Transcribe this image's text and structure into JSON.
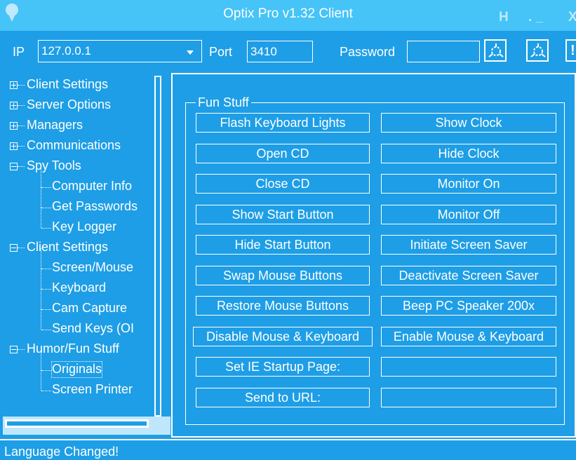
{
  "window": {
    "title": "Optix Pro v1.32 Client",
    "buttons": [
      "H",
      ". _",
      "X"
    ]
  },
  "connection": {
    "ip_label": "IP",
    "ip_value": "127.0.0.1",
    "port_label": "Port",
    "port_value": "3410",
    "password_label": "Password",
    "password_value": "",
    "action_buttons": [
      "connect-icon",
      "disconnect-icon",
      "!"
    ]
  },
  "sidebar": {
    "items": [
      {
        "label": "Client Settings",
        "level": 0,
        "expander": "plus"
      },
      {
        "label": "Server Options",
        "level": 0,
        "expander": "plus"
      },
      {
        "label": "Managers",
        "level": 0,
        "expander": "plus"
      },
      {
        "label": "Communications",
        "level": 0,
        "expander": "plus"
      },
      {
        "label": "Spy Tools",
        "level": 0,
        "expander": "minus"
      },
      {
        "label": "Computer Info",
        "level": 1
      },
      {
        "label": "Get Passwords",
        "level": 1
      },
      {
        "label": "Key Logger",
        "level": 1
      },
      {
        "label": "Client Settings",
        "level": 0,
        "expander": "minus"
      },
      {
        "label": "Screen/Mouse",
        "level": 1
      },
      {
        "label": "Keyboard",
        "level": 1
      },
      {
        "label": "Cam Capture",
        "level": 1
      },
      {
        "label": "Send Keys (OI",
        "level": 1
      },
      {
        "label": "Humor/Fun Stuff",
        "level": 0,
        "expander": "minus"
      },
      {
        "label": "Originals",
        "level": 1,
        "selected": true
      },
      {
        "label": "Screen Printer",
        "level": 1
      }
    ]
  },
  "fun_stuff": {
    "title": "Fun Stuff",
    "left_buttons": [
      "Flash Keyboard Lights",
      "Open CD",
      "Close CD",
      "Show Start Button",
      "Hide Start Button",
      "Swap Mouse Buttons",
      "Restore Mouse Buttons",
      "Disable Mouse & Keyboard",
      "Set IE Startup Page:",
      "Send to URL:"
    ],
    "right_buttons": [
      "Show Clock",
      "Hide Clock",
      "Monitor On",
      "Monitor Off",
      "Initiate Screen Saver",
      "Deactivate Screen Saver",
      "Beep PC Speaker 200x",
      "Enable Mouse & Keyboard"
    ],
    "ie_startup_value": "",
    "url_value": ""
  },
  "status": {
    "text": "Language Changed!"
  },
  "colors": {
    "background": "#1e9ee6",
    "titlebar": "#46c3f7",
    "foreground": "#ffffff"
  }
}
